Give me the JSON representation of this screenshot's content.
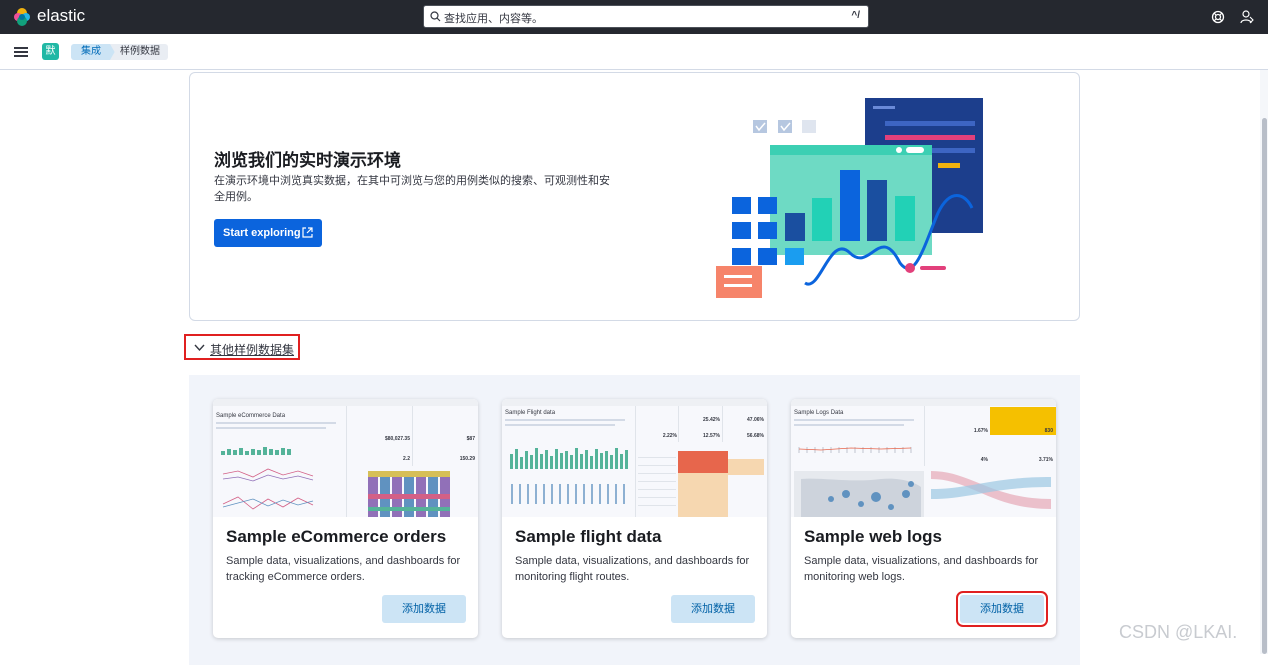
{
  "header": {
    "brand": "elastic",
    "search_placeholder": "查找应用、内容等。",
    "search_shortcut": "^/"
  },
  "breadcrumbs": {
    "space_initial": "默",
    "items": [
      "集成",
      "样例数据"
    ]
  },
  "hero": {
    "title": "浏览我们的实时演示环境",
    "description": "在演示环境中浏览真实数据，在其中可浏览与您的用例类似的搜索、可观测性和安全用例。",
    "button": "Start exploring"
  },
  "other_datasets": {
    "toggle_label": "其他样例数据集"
  },
  "cards": [
    {
      "title": "Sample eCommerce orders",
      "description": "Sample data, visualizations, and dashboards for tracking eCommerce orders.",
      "button": "添加数据",
      "thumb_title": "Sample eCommerce Data",
      "thumb_values": [
        "$80,027.35",
        "$87",
        "2.2",
        "150.29"
      ]
    },
    {
      "title": "Sample flight data",
      "description": "Sample data, visualizations, and dashboards for monitoring flight routes.",
      "button": "添加数据",
      "thumb_title": "Sample Flight data",
      "thumb_values": [
        "25.42%",
        "47.06%",
        "2.22%",
        "12.57%",
        "56.68%"
      ]
    },
    {
      "title": "Sample web logs",
      "description": "Sample data, visualizations, and dashboards for monitoring web logs.",
      "button": "添加数据",
      "thumb_title": "Sample Logs Data",
      "thumb_values": [
        "1.67%",
        "830",
        "4%",
        "3.71%"
      ]
    }
  ],
  "watermark": "CSDN @LKAI.",
  "colors": {
    "topbar": "#25282f",
    "primary": "#0b64dd",
    "add_button_bg": "#cce4f5",
    "highlight": "#e02020"
  }
}
